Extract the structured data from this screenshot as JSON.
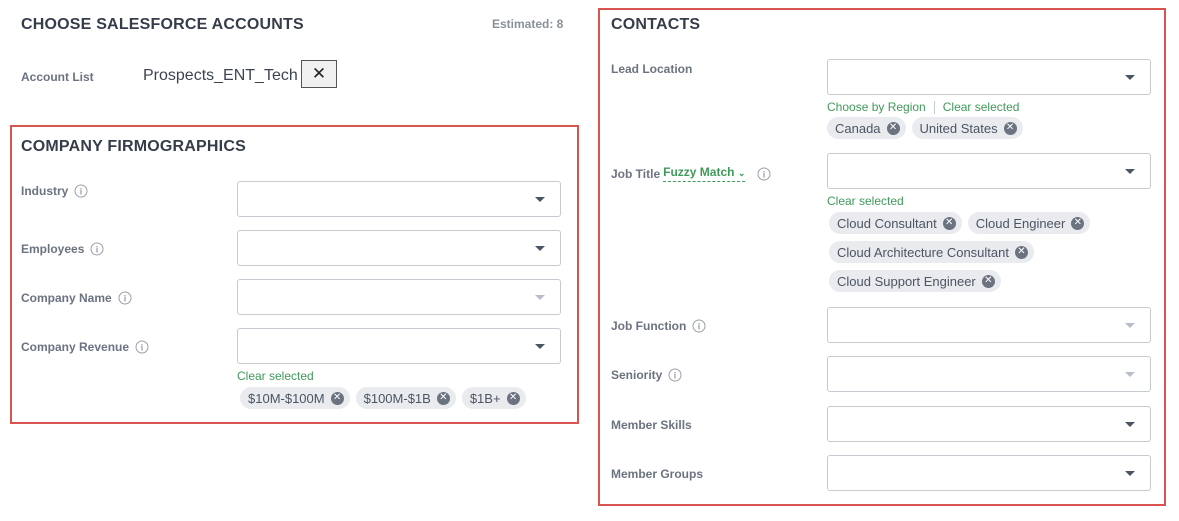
{
  "left": {
    "title": "CHOOSE SALESFORCE ACCOUNTS",
    "estimated": "Estimated: 8",
    "account_list_label": "Account List",
    "account_list_value": "Prospects_ENT_Tech",
    "account_list_clear": "✕"
  },
  "firmographics": {
    "title": "COMPANY FIRMOGRAPHICS",
    "industry_label": "Industry",
    "employees_label": "Employees",
    "company_name_label": "Company Name",
    "company_revenue_label": "Company Revenue",
    "revenue_clear": "Clear selected",
    "revenue_chips": [
      "$10M-$100M",
      "$100M-$1B",
      "$1B+"
    ]
  },
  "contacts": {
    "title": "CONTACTS",
    "lead_location_label": "Lead Location",
    "choose_by_region": "Choose by Region",
    "location_clear": "Clear selected",
    "location_chips": [
      "Canada",
      "United States"
    ],
    "job_title_label": "Job Title",
    "fuzzy_match": "Fuzzy Match",
    "job_title_clear": "Clear selected",
    "job_title_chips": [
      "Cloud Consultant",
      "Cloud Engineer",
      "Cloud Architecture Consultant",
      "Cloud Support Engineer"
    ],
    "job_function_label": "Job Function",
    "seniority_label": "Seniority",
    "member_skills_label": "Member Skills",
    "member_groups_label": "Member Groups"
  },
  "colors": {
    "highlight_box": "#d9534f",
    "accent_green": "#3f9a5a"
  }
}
